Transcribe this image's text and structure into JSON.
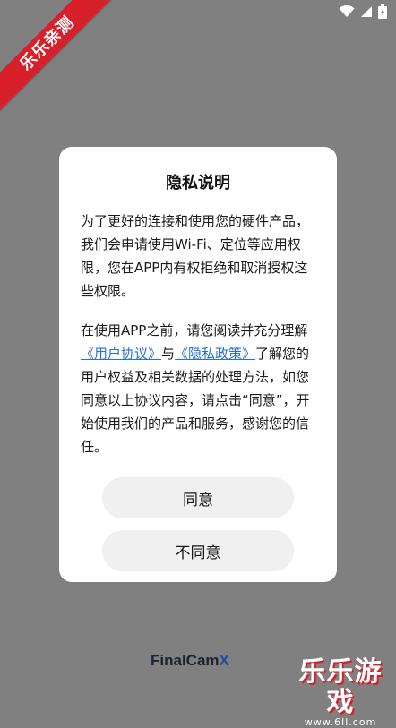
{
  "promo_ribbon": {
    "text": "乐乐亲测"
  },
  "status_bar": {
    "icons": [
      "wifi-icon",
      "signal-icon",
      "battery-charging-icon"
    ]
  },
  "dialog": {
    "title": "隐私说明",
    "paragraph1": "为了更好的连接和使用您的硬件产品，我们会申请使用Wi-Fi、定位等应用权限，您在APP内有权拒绝和取消授权这些权限。",
    "paragraph2_before": "在使用APP之前，请您阅读并充分理解",
    "user_agreement_link": "《用户协议》",
    "paragraph2_and": "与",
    "privacy_policy_link": "《隐私政策》",
    "paragraph2_after": "了解您的用户权益及相关数据的处理方法，如您同意以上协议内容，请点击“同意”，开始使用我们的产品和服务，感谢您的信任。",
    "agree_label": "同意",
    "disagree_label": "不同意"
  },
  "app_logo": {
    "text_main": "FinalCam",
    "text_accent": "X"
  },
  "watermark": {
    "title": "乐乐游戏",
    "url": "www.6ll.com"
  },
  "colors": {
    "overlay": "#808080",
    "link": "#2a6fd6",
    "ribbon": "#d8202a"
  }
}
